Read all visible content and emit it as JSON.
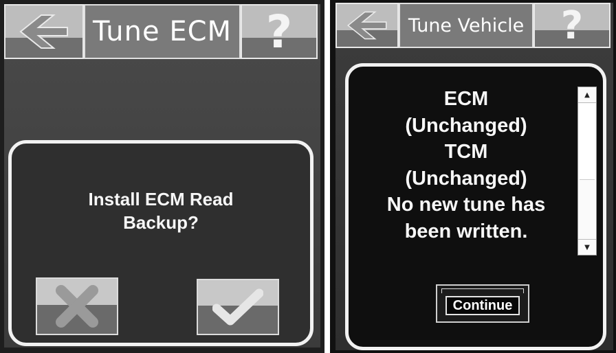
{
  "left_screen": {
    "title": "Tune ECM",
    "dialog_message": "Install ECM Read Backup?",
    "back_icon": "back-arrow-icon",
    "help_icon": "question-mark-icon",
    "cancel_icon": "x-icon",
    "confirm_icon": "checkmark-icon",
    "help_symbol": "?"
  },
  "right_screen": {
    "title": "Tune Vehicle",
    "help_symbol": "?",
    "message_lines": [
      "ECM",
      "(Unchanged)",
      "TCM",
      "(Unchanged)",
      "No new tune has",
      "been written."
    ],
    "scroll_up_glyph": "▲",
    "scroll_down_glyph": "▼",
    "continue_label": "Continue"
  }
}
